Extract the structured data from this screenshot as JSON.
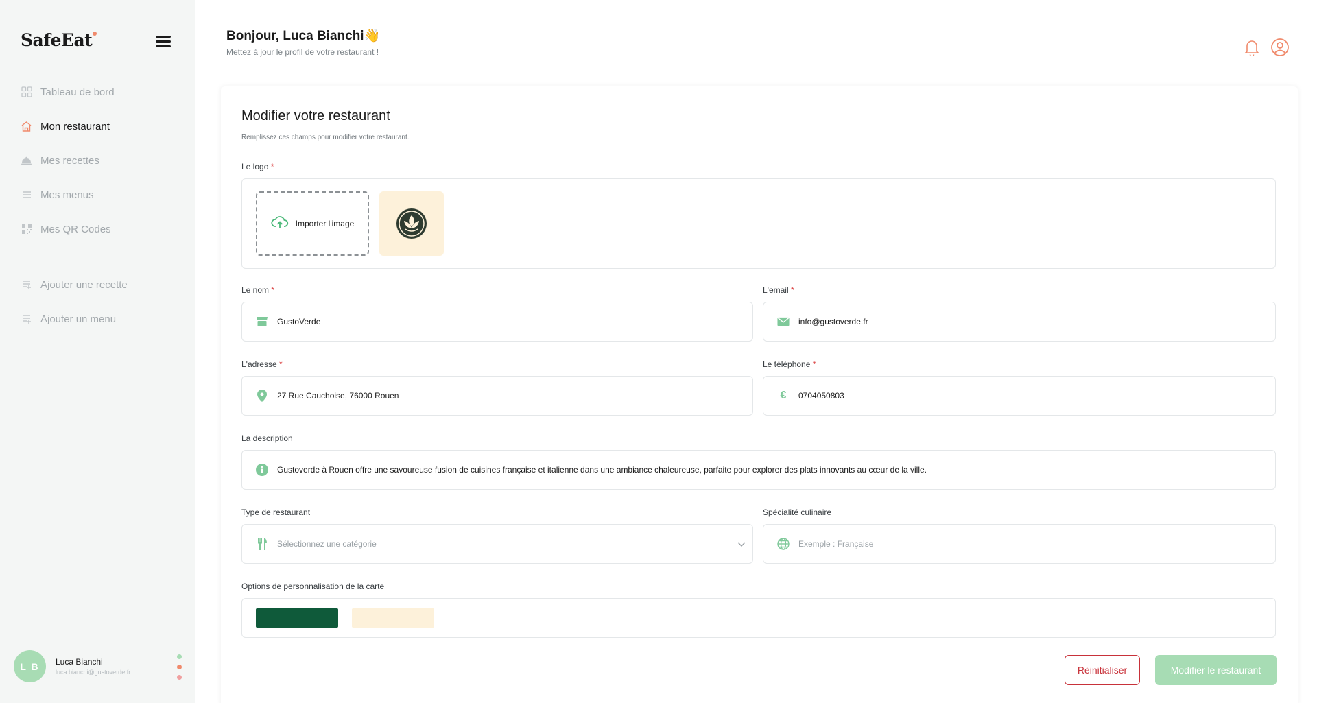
{
  "app": {
    "brand": "SafeEat"
  },
  "colors": {
    "accent": "#0f5a3a",
    "accent_light": "#a7dcb4",
    "danger": "#c8323a",
    "notification": "#f08a6c"
  },
  "sidebar": {
    "items": [
      {
        "label": "Tableau de bord",
        "icon": "dashboard-icon"
      },
      {
        "label": "Mon restaurant",
        "icon": "restaurant-icon",
        "active": true
      },
      {
        "label": "Mes recettes",
        "icon": "cloche-icon"
      },
      {
        "label": "Mes menus",
        "icon": "menu-list-icon"
      },
      {
        "label": "Mes QR Codes",
        "icon": "qr-code-icon"
      }
    ],
    "actions": [
      {
        "label": "Ajouter une recette",
        "icon": "add-list-icon"
      },
      {
        "label": "Ajouter un menu",
        "icon": "add-list-icon"
      }
    ],
    "profile": {
      "initials": "L B",
      "name": "Luca Bianchi",
      "email": "luca.bianchi@gustoverde.fr"
    }
  },
  "header": {
    "greeting": "Bonjour, Luca Bianchi👋",
    "subtitle": "Mettez à jour le profil de votre restaurant !"
  },
  "form": {
    "title": "Modifier votre restaurant",
    "subtitle": "Remplissez ces champs pour modifier votre restaurant.",
    "logo": {
      "label": "Le logo",
      "upload_label": "Importer l'image"
    },
    "name": {
      "label": "Le nom",
      "value": "GustoVerde"
    },
    "email": {
      "label": "L'email",
      "value": "info@gustoverde.fr"
    },
    "address": {
      "label": "L'adresse",
      "value": "27 Rue Cauchoise, 76000 Rouen"
    },
    "phone": {
      "label": "Le téléphone",
      "value": "0704050803"
    },
    "description": {
      "label": "La description",
      "value": "Gustoverde à Rouen offre une savoureuse fusion de cuisines française et italienne dans une ambiance chaleureuse, parfaite pour explorer des plats innovants au cœur de la ville."
    },
    "type": {
      "label": "Type de restaurant",
      "placeholder": "Sélectionnez une catégorie"
    },
    "specialty": {
      "label": "Spécialité culinaire",
      "placeholder": "Exemple : Française"
    },
    "customization": {
      "label": "Options de personnalisation de la carte",
      "primary_color": "#0f5a3a",
      "secondary_color": "#fdf1da"
    },
    "reset_label": "Réinitialiser",
    "submit_label": "Modifier le restaurant"
  }
}
